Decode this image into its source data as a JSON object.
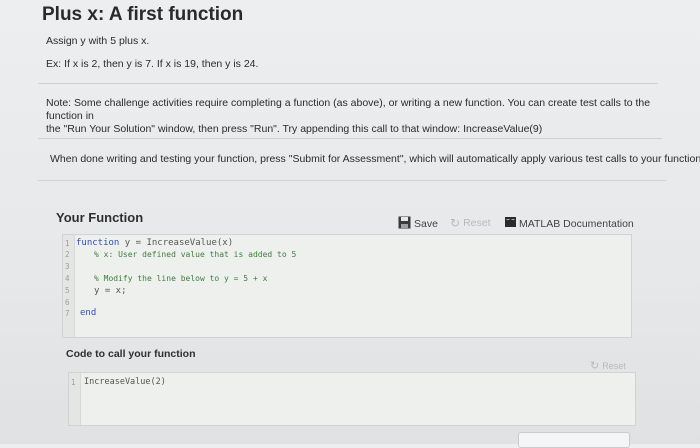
{
  "problem": {
    "title": "Plus x: A first function",
    "line1": "Assign y with 5 plus x.",
    "line2": "Ex: If x is 2, then y is 7. If x is 19, then y is 24.",
    "note_line1": "Note: Some challenge activities require completing a function (as above), or writing a new function. You can create test calls to the function in",
    "note_line2": "the \"Run Your Solution\" window, then press \"Run\". Try appending this call to that window: IncreaseValue(9)",
    "submit_note": "When done writing and testing your function, press \"Submit for Assessment\", which will automatically apply various test calls to your function."
  },
  "your_function": {
    "header": "Your Function",
    "save_label": "Save",
    "reset_label": "Reset",
    "docs_label": "MATLAB Documentation",
    "line_numbers": [
      "1",
      "2",
      "3",
      "4",
      "5",
      "6",
      "7"
    ],
    "code": {
      "l1_kw": "function",
      "l1_rest": " y = IncreaseValue(x)",
      "l2": "% x: User defined value that is added to 5",
      "l4": "% Modify the line below to y = 5 + x",
      "l5": "y = x;",
      "l7": "end"
    }
  },
  "call_code": {
    "header": "Code to call your function",
    "reset_label": "Reset",
    "line_number": "1",
    "code": "IncreaseValue(2)"
  }
}
